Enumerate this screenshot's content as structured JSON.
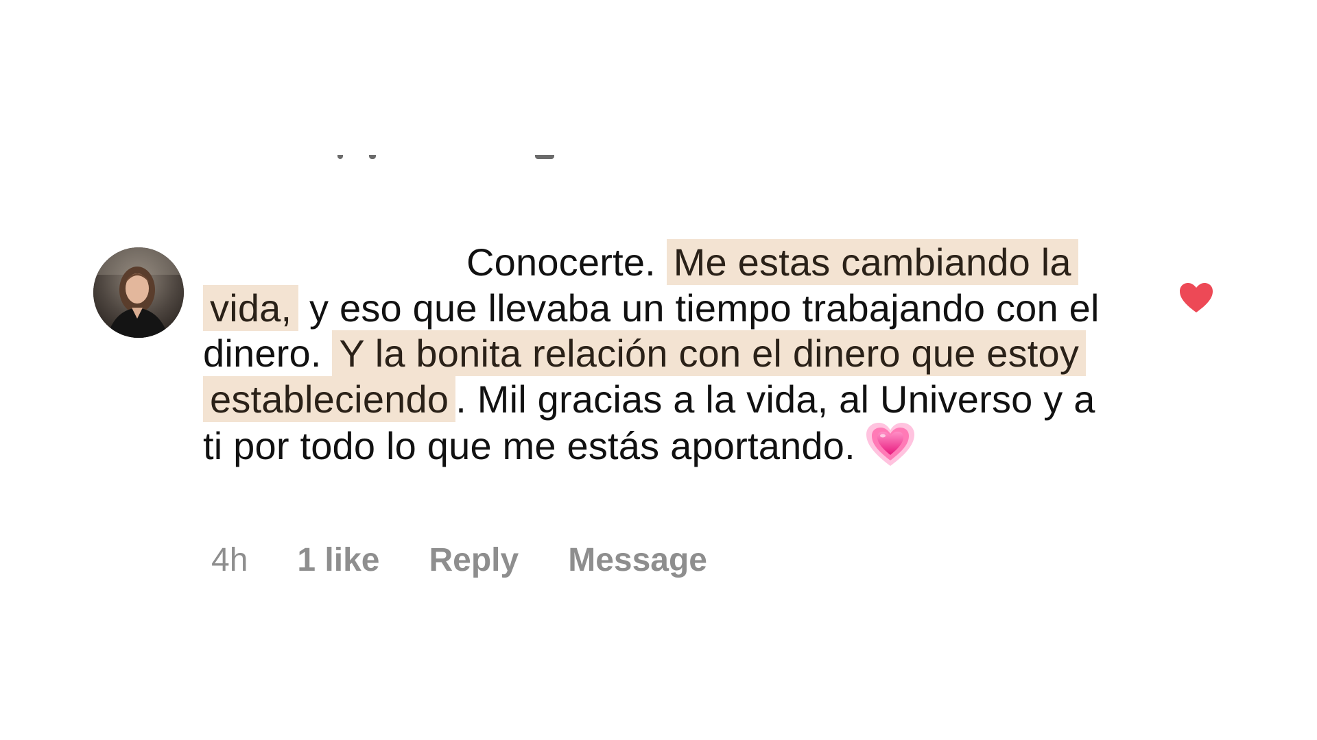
{
  "comment": {
    "segments": {
      "s1": "Conocerte. ",
      "h1": "Me estas cambiando la vida,",
      "s2": " y eso que llevaba un tiempo trabajando con el dinero. ",
      "h2": "Y la bonita relación con el dinero que estoy estableciendo",
      "s3": ". Mil gracias a la vida, al Universo y a ti por todo lo que me estás aportando."
    },
    "emoji_icon": "growing-heart-emoji",
    "highlight_color": "#f3e3d2"
  },
  "meta": {
    "time": "4h",
    "likes": "1 like",
    "reply": "Reply",
    "message": "Message"
  },
  "like_icon": "filled-heart-icon",
  "like_color": "#ed4956"
}
